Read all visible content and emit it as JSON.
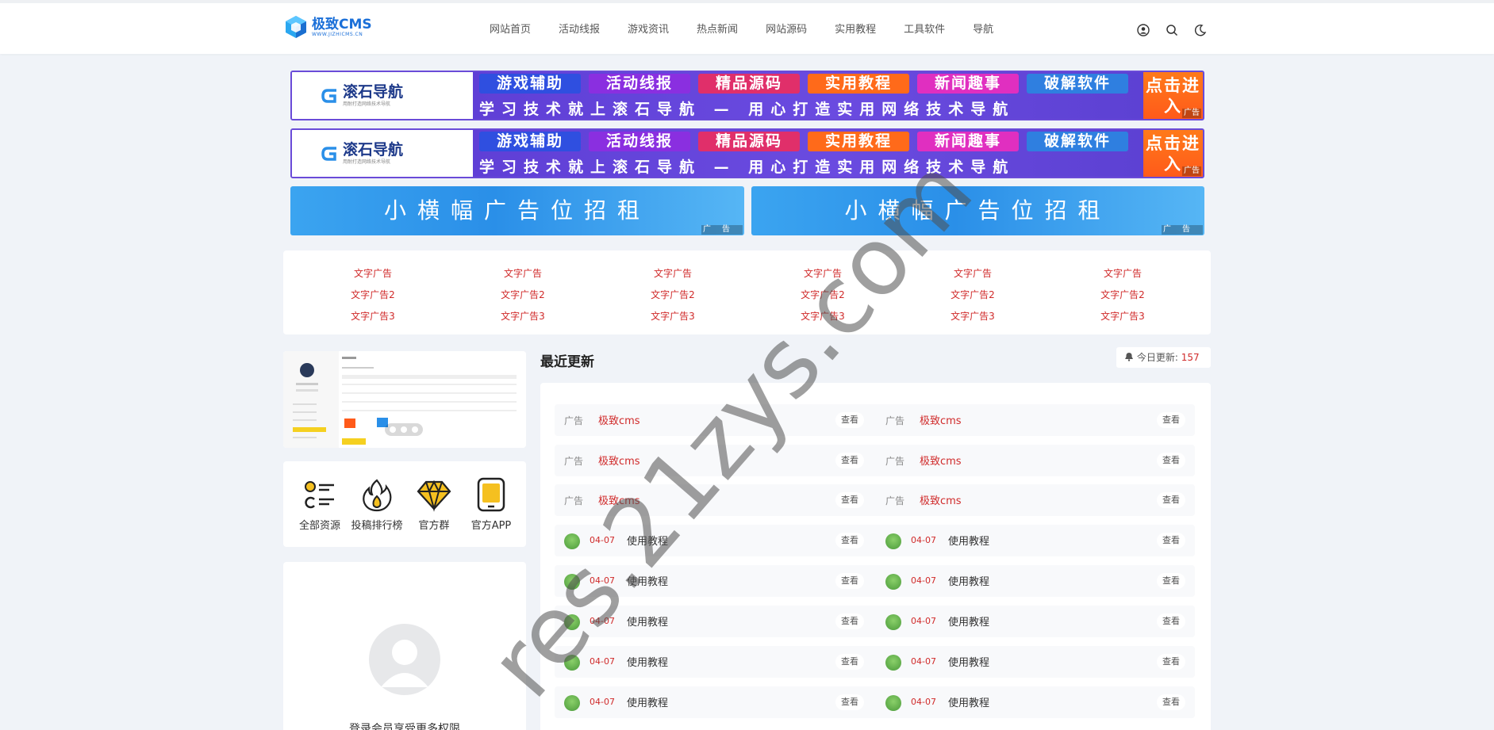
{
  "header": {
    "logo_main": "极致CMS",
    "logo_sub": "WWW.JIZHICMS.CN",
    "nav": [
      "网站首页",
      "活动线报",
      "游戏资讯",
      "热点新闻",
      "网站源码",
      "实用教程",
      "工具软件",
      "导航"
    ],
    "icons": [
      "user-icon",
      "search-icon",
      "moon-icon"
    ]
  },
  "banners": [
    {
      "brand": "滚石导航",
      "brand_sub": "用耐打造网络技术导航",
      "tags": [
        "游戏辅助",
        "活动线报",
        "精品源码",
        "实用教程",
        "新闻趣事",
        "破解软件"
      ],
      "tag_colors": [
        "#2f4fe0",
        "#8a2fe0",
        "#e02f6a",
        "#ff6a1a",
        "#e02fc0",
        "#2f7fe0"
      ],
      "slogan": "学习技术就上滚石导航 — 用心打造实用网络技术导航",
      "cta": "点击进入",
      "ad": "广告"
    },
    {
      "brand": "滚石导航",
      "brand_sub": "用耐打造网络技术导航",
      "tags": [
        "游戏辅助",
        "活动线报",
        "精品源码",
        "实用教程",
        "新闻趣事",
        "破解软件"
      ],
      "tag_colors": [
        "#2f4fe0",
        "#8a2fe0",
        "#e02f6a",
        "#ff6a1a",
        "#e02fc0",
        "#2f7fe0"
      ],
      "slogan": "学习技术就上滚石导航 — 用心打造实用网络技术导航",
      "cta": "点击进入",
      "ad": "广告"
    }
  ],
  "small_banners": [
    {
      "text": "小横幅广告位招租",
      "ad": "广告"
    },
    {
      "text": "小横幅广告位招租",
      "ad": "广告"
    }
  ],
  "text_ads": [
    [
      "文字广告",
      "文字广告2",
      "文字广告3"
    ],
    [
      "文字广告",
      "文字广告2",
      "文字广告3"
    ],
    [
      "文字广告",
      "文字广告2",
      "文字广告3"
    ],
    [
      "文字广告",
      "文字广告2",
      "文字广告3"
    ],
    [
      "文字广告",
      "文字广告2",
      "文字广告3"
    ],
    [
      "文字广告",
      "文字广告2",
      "文字广告3"
    ]
  ],
  "quick_links": [
    {
      "label": "全部资源",
      "icon": "list-icon"
    },
    {
      "label": "投稿排行榜",
      "icon": "fire-icon"
    },
    {
      "label": "官方群",
      "icon": "diamond-icon"
    },
    {
      "label": "官方APP",
      "icon": "app-icon"
    }
  ],
  "login": {
    "text": "登录会员享受更多权限"
  },
  "main": {
    "title": "最近更新",
    "today_label": "今日更新:",
    "today_count": "157",
    "view_label": "查看",
    "ad_label": "广告",
    "ad_title": "极致cms",
    "post_date": "04-07",
    "post_title": "使用教程"
  },
  "watermark": "res.21zys.com"
}
